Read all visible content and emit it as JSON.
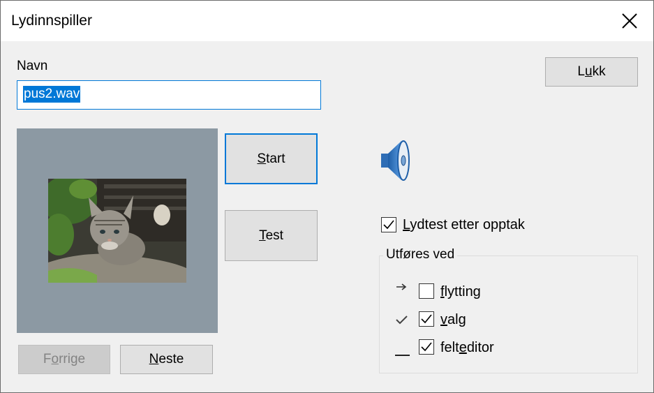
{
  "window": {
    "title": "Lydinnspiller"
  },
  "name_field": {
    "label": "Navn",
    "value": "pus2.wav"
  },
  "buttons": {
    "close": "Lukk",
    "start": "Start",
    "test": "Test",
    "previous": "Forrige",
    "next": "Neste"
  },
  "icons": {
    "close": "close-icon",
    "speaker": "speaker-icon",
    "arrow": "arrow-right-icon",
    "check": "checkmark-icon",
    "underscore": "underscore-icon"
  },
  "options": {
    "sound_test": {
      "label": "Lydtest etter opptak",
      "checked": true
    }
  },
  "group": {
    "title": "Utføres ved",
    "items": [
      {
        "label": "flytting",
        "checked": false
      },
      {
        "label": "valg",
        "checked": true
      },
      {
        "label": "felteditor",
        "checked": true
      }
    ]
  },
  "colors": {
    "accent": "#0078d7",
    "preview_bg": "#8c99a3",
    "dialog_bg": "#f0f0f0"
  }
}
